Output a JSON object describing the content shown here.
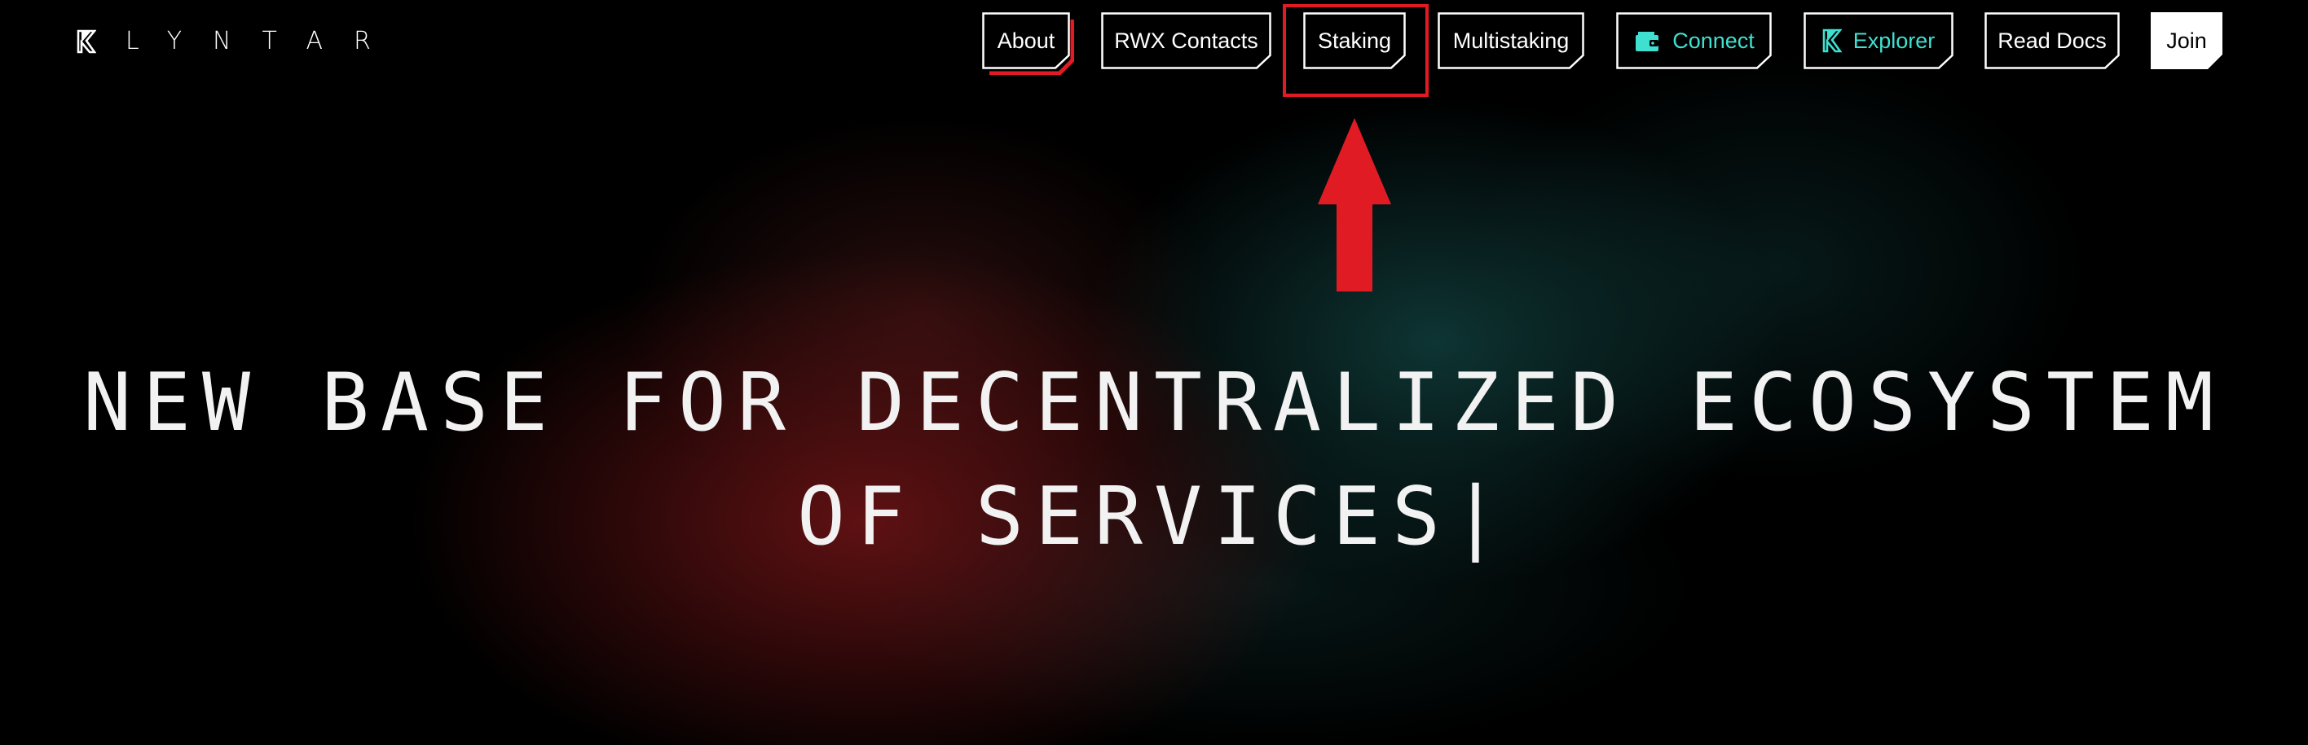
{
  "brand": {
    "name": "KLYNTAR",
    "logo_text": "LYNTAR"
  },
  "nav": {
    "about": "About",
    "rwx_contacts": "RWX Contacts",
    "staking": "Staking",
    "multistaking": "Multistaking",
    "connect": "Connect",
    "explorer": "Explorer",
    "read_docs": "Read Docs",
    "join": "Join"
  },
  "hero": {
    "line1": "NEW BASE FOR DECENTRALIZED ECOSYSTEM",
    "line2": "OF SERVICES|"
  },
  "colors": {
    "background": "#000000",
    "accent_teal": "#3fe0d0",
    "accent_red": "#e11b24"
  },
  "icons": {
    "connect": "wallet-icon",
    "explorer": "klyntar-k-icon",
    "logo": "klyntar-logo-icon"
  },
  "annotation": {
    "highlight_target": "staking-nav-button"
  }
}
